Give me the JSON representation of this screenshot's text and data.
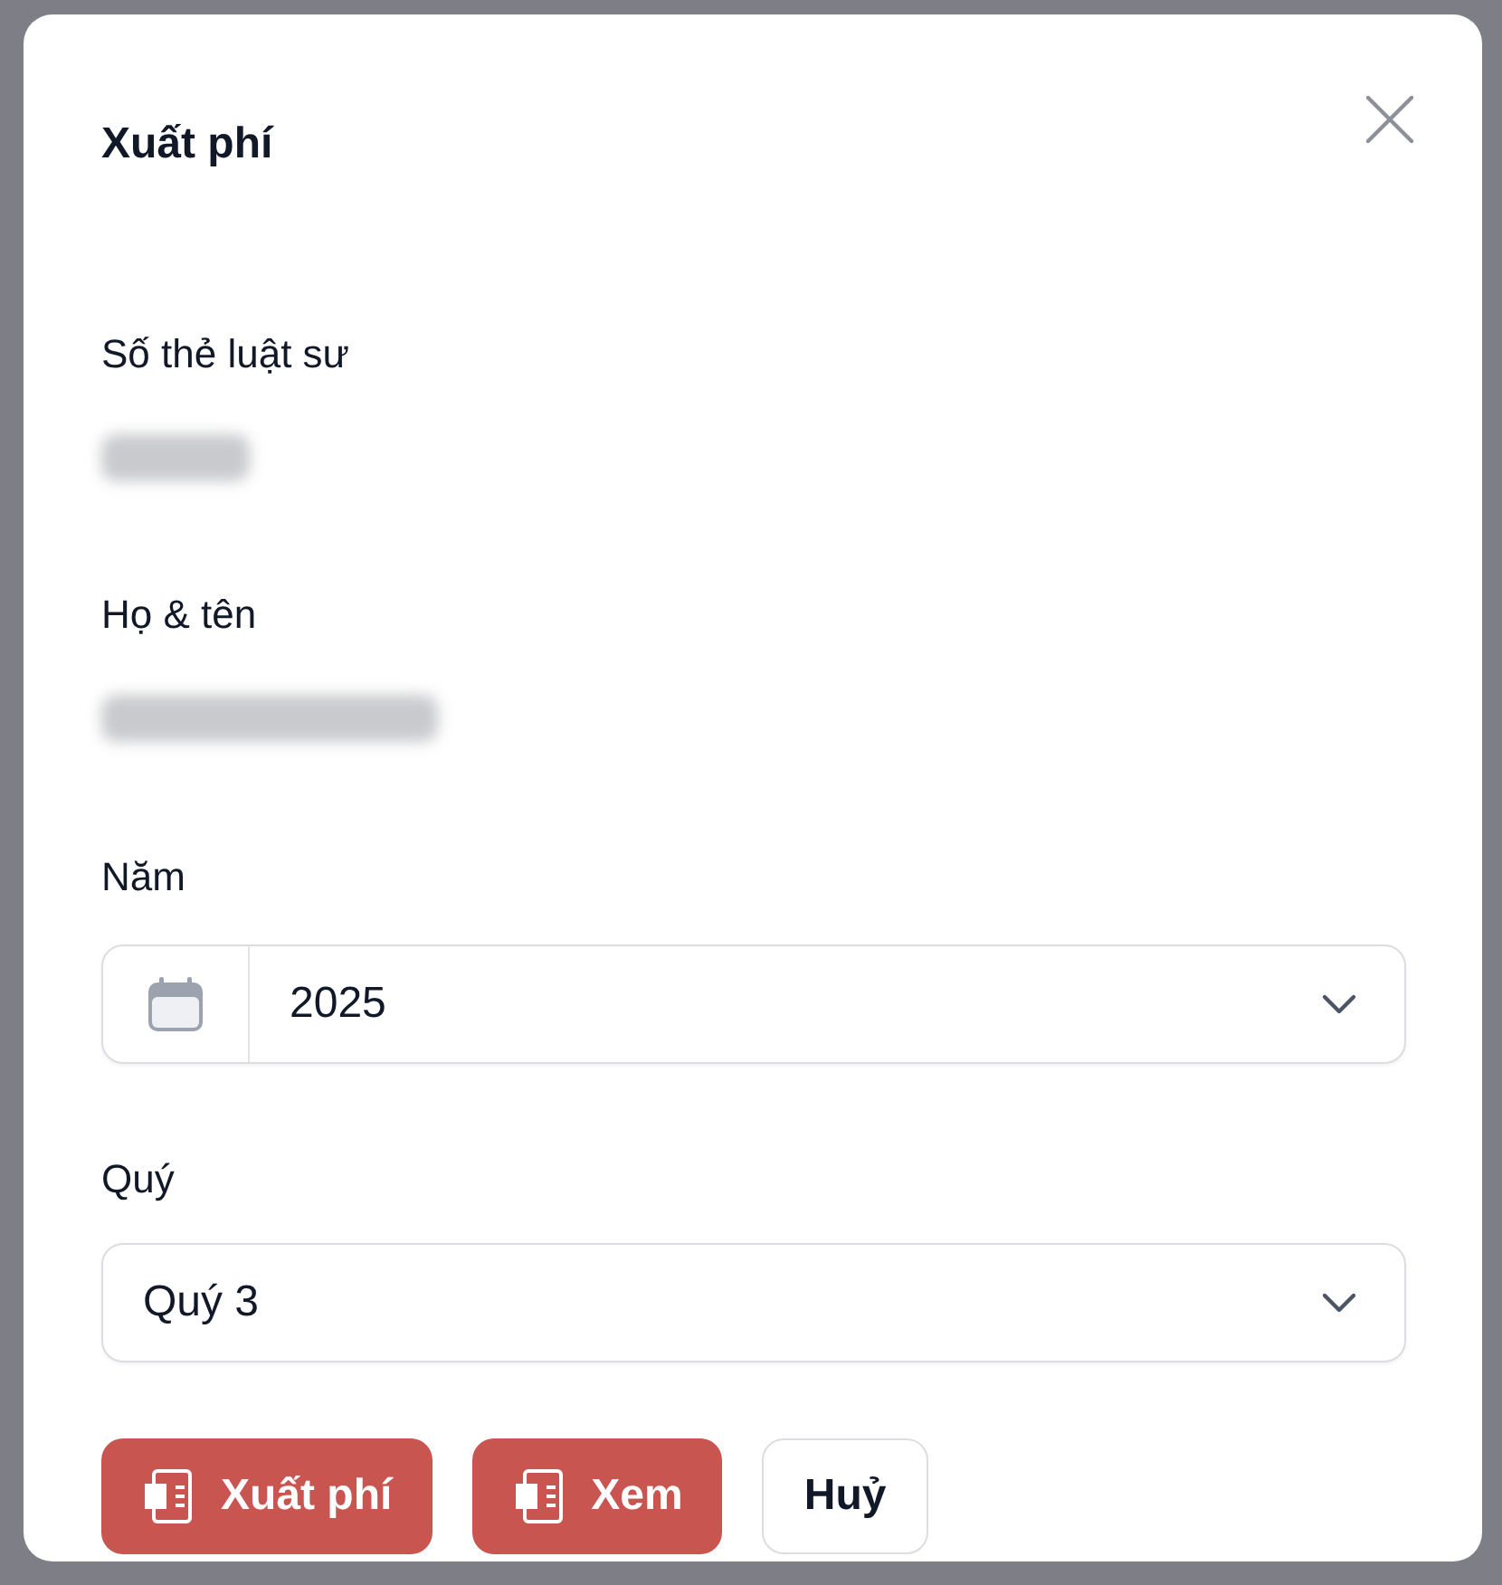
{
  "dialog": {
    "title": "Xuất phí",
    "fields": [
      {
        "kind": "redacted",
        "label": "Số thẻ luật sư"
      },
      {
        "kind": "redacted",
        "label": "Họ & tên"
      },
      {
        "kind": "date-select",
        "label": "Năm",
        "value": "2025"
      },
      {
        "kind": "select",
        "label": "Quý",
        "value": "Quý 3"
      }
    ],
    "buttons": [
      {
        "kind": "primary",
        "label": "Xuất phí"
      },
      {
        "kind": "primary",
        "label": "Xem"
      },
      {
        "kind": "secondary",
        "label": "Huỷ"
      }
    ]
  }
}
